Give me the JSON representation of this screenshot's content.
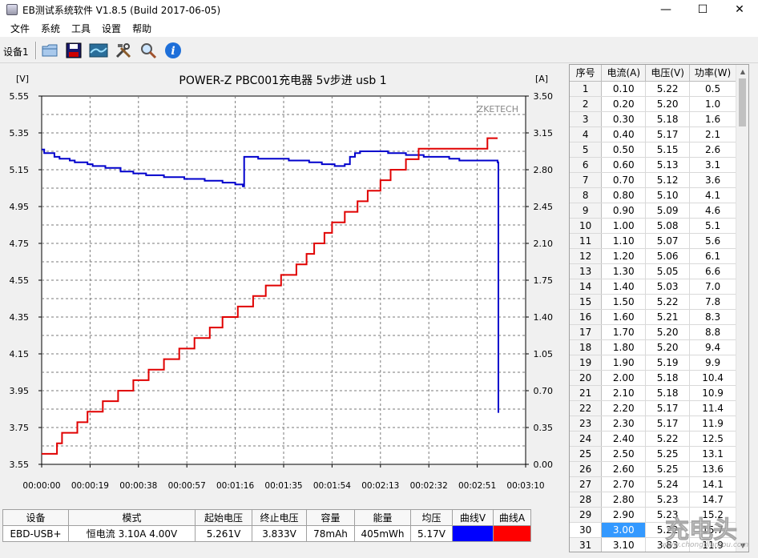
{
  "window": {
    "title": "EB测试系统软件 V1.8.5 (Build 2017-06-05)",
    "minimize": "—",
    "maximize": "☐",
    "close": "✕"
  },
  "menu": [
    "文件",
    "系统",
    "工具",
    "设置",
    "帮助"
  ],
  "toolbar": {
    "device_tab": "设备1",
    "icons": [
      "folder-icon",
      "save-icon",
      "chart-icon",
      "tools-icon",
      "search-icon",
      "info-icon"
    ]
  },
  "chart_data": {
    "type": "line",
    "title": "POWER-Z PBC001充电器 5v步进  usb 1",
    "watermark": "ZKETECH",
    "left_unit": "[V]",
    "right_unit": "[A]",
    "ylim_left": [
      3.55,
      5.55
    ],
    "ylim_right": [
      0.0,
      3.5
    ],
    "xlim_seconds": [
      0,
      190
    ],
    "left_ticks": [
      "5.55",
      "5.35",
      "5.15",
      "4.95",
      "4.75",
      "4.55",
      "4.35",
      "4.15",
      "3.95",
      "3.75",
      "3.55"
    ],
    "right_ticks": [
      "3.50",
      "3.15",
      "2.80",
      "2.45",
      "2.10",
      "1.75",
      "1.40",
      "1.05",
      "0.70",
      "0.35",
      "0.00"
    ],
    "x_ticks": [
      "00:00:00",
      "00:00:19",
      "00:00:38",
      "00:00:57",
      "00:01:16",
      "00:01:35",
      "00:01:54",
      "00:02:13",
      "00:02:32",
      "00:02:51",
      "00:03:10"
    ],
    "colors": {
      "voltage": "#0000cc",
      "current": "#e00000"
    },
    "series": [
      {
        "name": "电压",
        "axis": "left",
        "t": [
          0,
          1,
          5,
          7,
          11,
          13,
          18,
          20,
          25,
          31,
          36,
          41,
          48,
          56,
          64,
          71,
          76,
          79,
          79.5,
          80,
          85,
          90,
          97,
          105,
          110,
          115,
          119,
          121,
          123,
          125,
          136,
          143,
          150,
          160,
          164,
          179,
          179.3
        ],
        "values": [
          5.26,
          5.24,
          5.22,
          5.21,
          5.2,
          5.19,
          5.18,
          5.17,
          5.16,
          5.14,
          5.13,
          5.12,
          5.11,
          5.1,
          5.09,
          5.08,
          5.07,
          5.06,
          5.22,
          5.22,
          5.21,
          5.21,
          5.2,
          5.19,
          5.18,
          5.17,
          5.18,
          5.22,
          5.24,
          5.25,
          5.24,
          5.23,
          5.22,
          5.21,
          5.2,
          5.19,
          3.83
        ]
      },
      {
        "name": "电流",
        "axis": "right",
        "t": [
          0,
          2,
          6,
          8,
          14,
          18,
          24,
          30,
          36,
          42,
          48,
          54,
          60,
          66,
          71,
          77,
          83,
          88,
          94,
          100,
          104,
          107,
          111,
          114,
          119,
          124,
          128,
          133,
          137,
          143,
          148,
          152,
          156,
          160,
          164,
          170,
          175,
          178,
          179
        ],
        "values": [
          0.1,
          0.1,
          0.2,
          0.3,
          0.4,
          0.5,
          0.6,
          0.7,
          0.8,
          0.9,
          1.0,
          1.1,
          1.2,
          1.3,
          1.4,
          1.5,
          1.6,
          1.7,
          1.8,
          1.9,
          2.0,
          2.1,
          2.2,
          2.3,
          2.4,
          2.5,
          2.6,
          2.7,
          2.8,
          2.9,
          3.0,
          3.0,
          3.0,
          3.0,
          3.0,
          3.0,
          3.1,
          3.1,
          3.1
        ]
      }
    ]
  },
  "table": {
    "headers": [
      "序号",
      "电流(A)",
      "电压(V)",
      "功率(W)"
    ],
    "rows": [
      [
        "1",
        "0.10",
        "5.22",
        "0.5"
      ],
      [
        "2",
        "0.20",
        "5.20",
        "1.0"
      ],
      [
        "3",
        "0.30",
        "5.18",
        "1.6"
      ],
      [
        "4",
        "0.40",
        "5.17",
        "2.1"
      ],
      [
        "5",
        "0.50",
        "5.15",
        "2.6"
      ],
      [
        "6",
        "0.60",
        "5.13",
        "3.1"
      ],
      [
        "7",
        "0.70",
        "5.12",
        "3.6"
      ],
      [
        "8",
        "0.80",
        "5.10",
        "4.1"
      ],
      [
        "9",
        "0.90",
        "5.09",
        "4.6"
      ],
      [
        "10",
        "1.00",
        "5.08",
        "5.1"
      ],
      [
        "11",
        "1.10",
        "5.07",
        "5.6"
      ],
      [
        "12",
        "1.20",
        "5.06",
        "6.1"
      ],
      [
        "13",
        "1.30",
        "5.05",
        "6.6"
      ],
      [
        "14",
        "1.40",
        "5.03",
        "7.0"
      ],
      [
        "15",
        "1.50",
        "5.22",
        "7.8"
      ],
      [
        "16",
        "1.60",
        "5.21",
        "8.3"
      ],
      [
        "17",
        "1.70",
        "5.20",
        "8.8"
      ],
      [
        "18",
        "1.80",
        "5.20",
        "9.4"
      ],
      [
        "19",
        "1.90",
        "5.19",
        "9.9"
      ],
      [
        "20",
        "2.00",
        "5.18",
        "10.4"
      ],
      [
        "21",
        "2.10",
        "5.18",
        "10.9"
      ],
      [
        "22",
        "2.20",
        "5.17",
        "11.4"
      ],
      [
        "23",
        "2.30",
        "5.17",
        "11.9"
      ],
      [
        "24",
        "2.40",
        "5.22",
        "12.5"
      ],
      [
        "25",
        "2.50",
        "5.25",
        "13.1"
      ],
      [
        "26",
        "2.60",
        "5.25",
        "13.6"
      ],
      [
        "27",
        "2.70",
        "5.24",
        "14.1"
      ],
      [
        "28",
        "2.80",
        "5.23",
        "14.7"
      ],
      [
        "29",
        "2.90",
        "5.23",
        "15.2"
      ],
      [
        "30",
        "3.00",
        "5.22",
        "15.7"
      ],
      [
        "31",
        "3.10",
        "3.83",
        "11.9"
      ]
    ],
    "selected_row": 30
  },
  "summary": {
    "headers": [
      "设备",
      "模式",
      "起始电压",
      "终止电压",
      "容量",
      "能量",
      "均压",
      "曲线V",
      "曲线A"
    ],
    "device": "EBD-USB+",
    "mode": "恒电流  3.10A  4.00V",
    "start_voltage": "5.261V",
    "end_voltage": "3.833V",
    "capacity": "78mAh",
    "energy": "405mWh",
    "avg_voltage": "5.17V"
  },
  "watermark": {
    "logo": "充电头",
    "url": "www.chongdiantou.com"
  }
}
